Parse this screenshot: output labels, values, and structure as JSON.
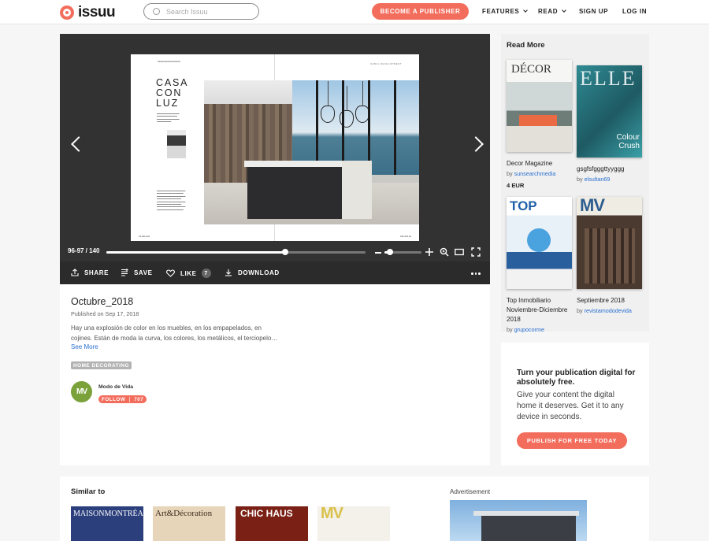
{
  "header": {
    "logo_text": "issuu",
    "search_placeholder": "Search Issuu",
    "become_publisher": "BECOME A PUBLISHER",
    "nav": {
      "features": "FEATURES",
      "read": "READ",
      "sign_up": "SIGN UP",
      "log_in": "LOG IN"
    }
  },
  "viewer": {
    "page_counter": "96-97 / 140",
    "progress_fraction": 0.69,
    "zoom_fraction": 0.15,
    "spread": {
      "article_title_lines": [
        "CASA",
        "CON",
        "LUZ"
      ],
      "section_label": "SABAL DEVELOPMENT"
    }
  },
  "actions": {
    "share": "SHARE",
    "save": "SAVE",
    "like": "LIKE",
    "like_count": "7",
    "download": "DOWNLOAD"
  },
  "document": {
    "title": "Octubre_2018",
    "published": "Published on Sep 17, 2018",
    "description": "Hay una explosión de color en los muebles, en los empapelados, en cojines. Están de moda la curva, los colores, los metálicos, el terciopelo…",
    "see_more": "See More",
    "tag": "HOME DECORATING",
    "author": {
      "initials": "MV",
      "name": "Modo de Vida",
      "follow_label": "FOLLOW",
      "follower_count": "707"
    }
  },
  "read_more": {
    "title": "Read More",
    "items": [
      {
        "name": "Decor Magazine",
        "by_prefix": "by",
        "by": "sunsearchmedia",
        "price": "4 EUR",
        "cover_title": "DÉCOR"
      },
      {
        "name": "gsgfsfgggttyyggg",
        "by_prefix": "by",
        "by": "elsultan69",
        "price": "",
        "cover_title": "ELLE",
        "cover_sub": "Colour Crush"
      },
      {
        "name": "Top Inmobiliario Noviembre-Diciembre 2018",
        "by_prefix": "by",
        "by": "grupocorme",
        "price": "",
        "cover_title": "TOP"
      },
      {
        "name": "Septiembre 2018",
        "by_prefix": "by",
        "by": "revistamododevida",
        "price": "",
        "cover_title": "MV"
      }
    ]
  },
  "promo": {
    "title": "Turn your publication digital for absolutely free.",
    "text": "Give your content the digital home it deserves. Get it to any device in seconds.",
    "button": "PUBLISH FOR FREE TODAY"
  },
  "similar": {
    "title": "Similar to",
    "covers": [
      {
        "title": "MAISONMONTRÉAL",
        "color": "#2b3f7c"
      },
      {
        "title": "Art&Décoration",
        "color": "#e7d5b9"
      },
      {
        "title": "CHIC HAUS",
        "color": "#7a2014"
      },
      {
        "title": "MV",
        "color": "#f3f1ea"
      }
    ]
  },
  "advertisement_label": "Advertisement",
  "colors": {
    "accent": "#f36d5d",
    "link": "#2a6fd1",
    "viewer_bg": "#323232"
  }
}
